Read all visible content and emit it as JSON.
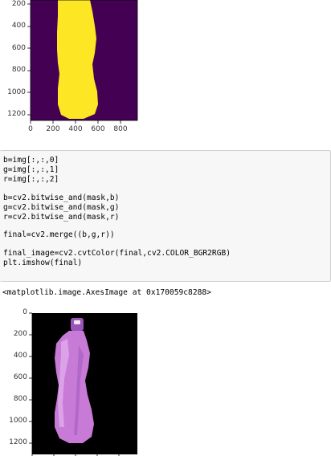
{
  "top_plot": {
    "y_ticks": [
      "200",
      "400",
      "600",
      "800",
      "1000",
      "1200"
    ],
    "x_ticks": [
      "0",
      "200",
      "400",
      "600",
      "800"
    ],
    "colors": {
      "background": "#440154",
      "foreground": "#fde725"
    }
  },
  "code_cell": {
    "lines": [
      "b=img[:,:,0]",
      "g=img[:,:,1]",
      "r=img[:,:,2]",
      "",
      "b=cv2.bitwise_and(mask,b)",
      "g=cv2.bitwise_and(mask,g)",
      "r=cv2.bitwise_and(mask,r)",
      "",
      "final=cv2.merge((b,g,r))",
      "",
      "final_image=cv2.cvtColor(final,cv2.COLOR_BGR2RGB)",
      "plt.imshow(final)"
    ]
  },
  "output": {
    "repr": "<matplotlib.image.AxesImage at 0x170059c8288>"
  },
  "bottom_plot": {
    "y_ticks": [
      "0",
      "200",
      "400",
      "600",
      "800",
      "1000",
      "1200"
    ],
    "colors": {
      "background": "#000000",
      "bottle": "#c77ad6",
      "cap": "#9a55b8"
    }
  }
}
